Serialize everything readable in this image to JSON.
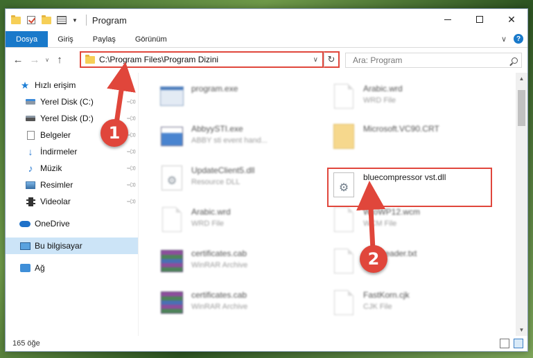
{
  "window": {
    "title": "Program"
  },
  "ribbon": {
    "tabs": [
      "Dosya",
      "Giriş",
      "Paylaş",
      "Görünüm"
    ],
    "help": "?"
  },
  "nav": {
    "address": "C:\\Program Files\\Program Dizini",
    "search_placeholder": "Ara: Program"
  },
  "sidebar": {
    "items": [
      {
        "label": "Hızlı erişim",
        "icon": "star-icon"
      },
      {
        "label": "Yerel Disk (C:)",
        "icon": "drive-icon"
      },
      {
        "label": "Yerel Disk (D:)",
        "icon": "drive-icon"
      },
      {
        "label": "Belgeler",
        "icon": "documents-icon"
      },
      {
        "label": "İndirmeler",
        "icon": "downloads-icon"
      },
      {
        "label": "Müzik",
        "icon": "music-icon"
      },
      {
        "label": "Resimler",
        "icon": "pictures-icon"
      },
      {
        "label": "Videolar",
        "icon": "videos-icon"
      },
      {
        "label": "OneDrive",
        "icon": "onedrive-icon"
      },
      {
        "label": "Bu bilgisayar",
        "icon": "computer-icon"
      },
      {
        "label": "Ağ",
        "icon": "network-icon"
      }
    ]
  },
  "files": [
    {
      "name": "program.exe",
      "desc": ""
    },
    {
      "name": "Arabic.wrd",
      "desc": "WRD File"
    },
    {
      "name": "AbbyySTI.exe",
      "desc": "ABBY sti event hand..."
    },
    {
      "name": "Microsoft.VC90.CRT",
      "desc": ""
    },
    {
      "name": "UpdateClient5.dll",
      "desc": "Resource DLL"
    },
    {
      "name": "bluecompressor vst.dll",
      "desc": ""
    },
    {
      "name": "Arabic.wrd",
      "desc": "WRD File"
    },
    {
      "name": "WtoWP12.wcm",
      "desc": "WCM File"
    },
    {
      "name": "certificates.cab",
      "desc": "WinRAR Archive"
    },
    {
      "name": "OneReader.txt",
      "desc": ""
    },
    {
      "name": "certificates.cab",
      "desc": "WinRAR Archive"
    },
    {
      "name": "FastKorn.cjk",
      "desc": "CJK File"
    }
  ],
  "status": {
    "count": "165 öğe"
  },
  "annotations": {
    "step1": "1",
    "step2": "2"
  },
  "colors": {
    "accent": "#1979ca",
    "highlight": "#e0463b",
    "selected": "#cce4f7"
  }
}
